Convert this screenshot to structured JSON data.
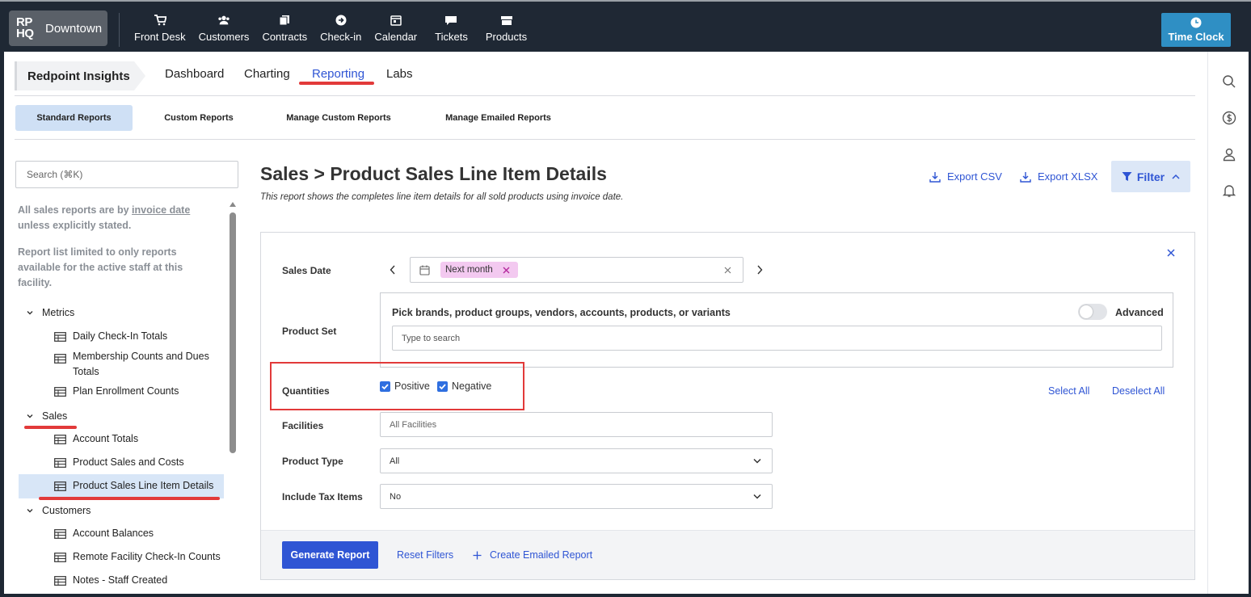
{
  "brand": {
    "logo": "RP HQ",
    "logo_line1": "RP",
    "logo_line2": "HQ",
    "location": "Downtown"
  },
  "nav": {
    "items": [
      {
        "label": "Front Desk",
        "icon": "cart-icon"
      },
      {
        "label": "Customers",
        "icon": "users-icon"
      },
      {
        "label": "Contracts",
        "icon": "contracts-icon"
      },
      {
        "label": "Check-in",
        "icon": "arrow-circle-icon"
      },
      {
        "label": "Calendar",
        "icon": "calendar-icon"
      },
      {
        "label": "Tickets",
        "icon": "chat-bubble-icon"
      },
      {
        "label": "Products",
        "icon": "box-icon"
      }
    ],
    "time_clock": "Time Clock"
  },
  "tabs": {
    "section": "Redpoint Insights",
    "items": [
      "Dashboard",
      "Charting",
      "Reporting",
      "Labs"
    ],
    "active": "Reporting"
  },
  "subtabs": {
    "items": [
      "Standard Reports",
      "Custom Reports",
      "Manage Custom Reports",
      "Manage Emailed Reports"
    ],
    "active": "Standard Reports"
  },
  "sidebar": {
    "search_placeholder": "Search (⌘K)",
    "note1_prefix": "All sales reports are by ",
    "note1_link": "invoice date",
    "note1_suffix": " unless explicitly stated.",
    "note2": "Report list limited to only reports available for the active staff at this facility.",
    "categories": [
      {
        "label": "Metrics",
        "items": [
          "Daily Check-In Totals",
          "Membership Counts and Dues Totals",
          "Plan Enrollment Counts"
        ]
      },
      {
        "label": "Sales",
        "items": [
          "Account Totals",
          "Product Sales and Costs",
          "Product Sales Line Item Details"
        ]
      },
      {
        "label": "Customers",
        "items": [
          "Account Balances",
          "Remote Facility Check-In Counts",
          "Notes - Staff Created"
        ]
      }
    ],
    "active_item": "Product Sales Line Item Details"
  },
  "main": {
    "title": "Sales > Product Sales Line Item Details",
    "description": "This report shows the completes line item details for all sold products using invoice date.",
    "export_csv": "Export CSV",
    "export_xlsx": "Export XLSX",
    "filter_label": "Filter"
  },
  "filters": {
    "sales_date_label": "Sales Date",
    "sales_date_chip": "Next month",
    "product_set_label": "Product Set",
    "product_set_heading": "Pick brands, product groups, vendors, accounts, products, or variants",
    "advanced_label": "Advanced",
    "advanced_enabled": false,
    "product_set_placeholder": "Type to search",
    "quantities_label": "Quantities",
    "positive_label": "Positive",
    "positive_checked": true,
    "negative_label": "Negative",
    "negative_checked": true,
    "select_all": "Select All",
    "deselect_all": "Deselect All",
    "facilities_label": "Facilities",
    "facilities_placeholder": "All Facilities",
    "product_type_label": "Product Type",
    "product_type_value": "All",
    "include_tax_label": "Include Tax Items",
    "include_tax_value": "No"
  },
  "actions": {
    "generate": "Generate Report",
    "reset": "Reset Filters",
    "create_emailed": "Create Emailed Report"
  },
  "colors": {
    "nav_bg": "#1f2834",
    "accent_blue": "#2f55d4",
    "time_clock_bg": "#2f8fc4",
    "chip_bg": "#f3c9f0",
    "annotation_red": "#e23a3a"
  }
}
